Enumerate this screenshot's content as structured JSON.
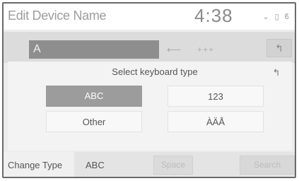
{
  "header": {
    "title": "Edit Device Name",
    "clock": "4:38",
    "status_icons": [
      "signal-icon",
      "battery-icon",
      "bluetooth-icon"
    ],
    "status_glyphs": [
      "⌄",
      "▯",
      "ϐ"
    ]
  },
  "input": {
    "value": "A",
    "backspace_glyph": "⟵",
    "more_glyph": "+++",
    "back_glyph": "↰"
  },
  "panel": {
    "title": "Select keyboard type",
    "back_glyph": "↰",
    "options": [
      {
        "label": "ABC",
        "selected": true
      },
      {
        "label": "123",
        "selected": false
      },
      {
        "label": "Other",
        "selected": false
      },
      {
        "label": "ÀÄÅ",
        "selected": false
      }
    ]
  },
  "bottom": {
    "change_type_label": "Change Type",
    "current_type": "ABC",
    "space_label": "Space",
    "search_label": "Search"
  },
  "colors": {
    "selected_option": "#9c9c9c",
    "text_field": "#8e8e8e",
    "background": "#ececec"
  }
}
